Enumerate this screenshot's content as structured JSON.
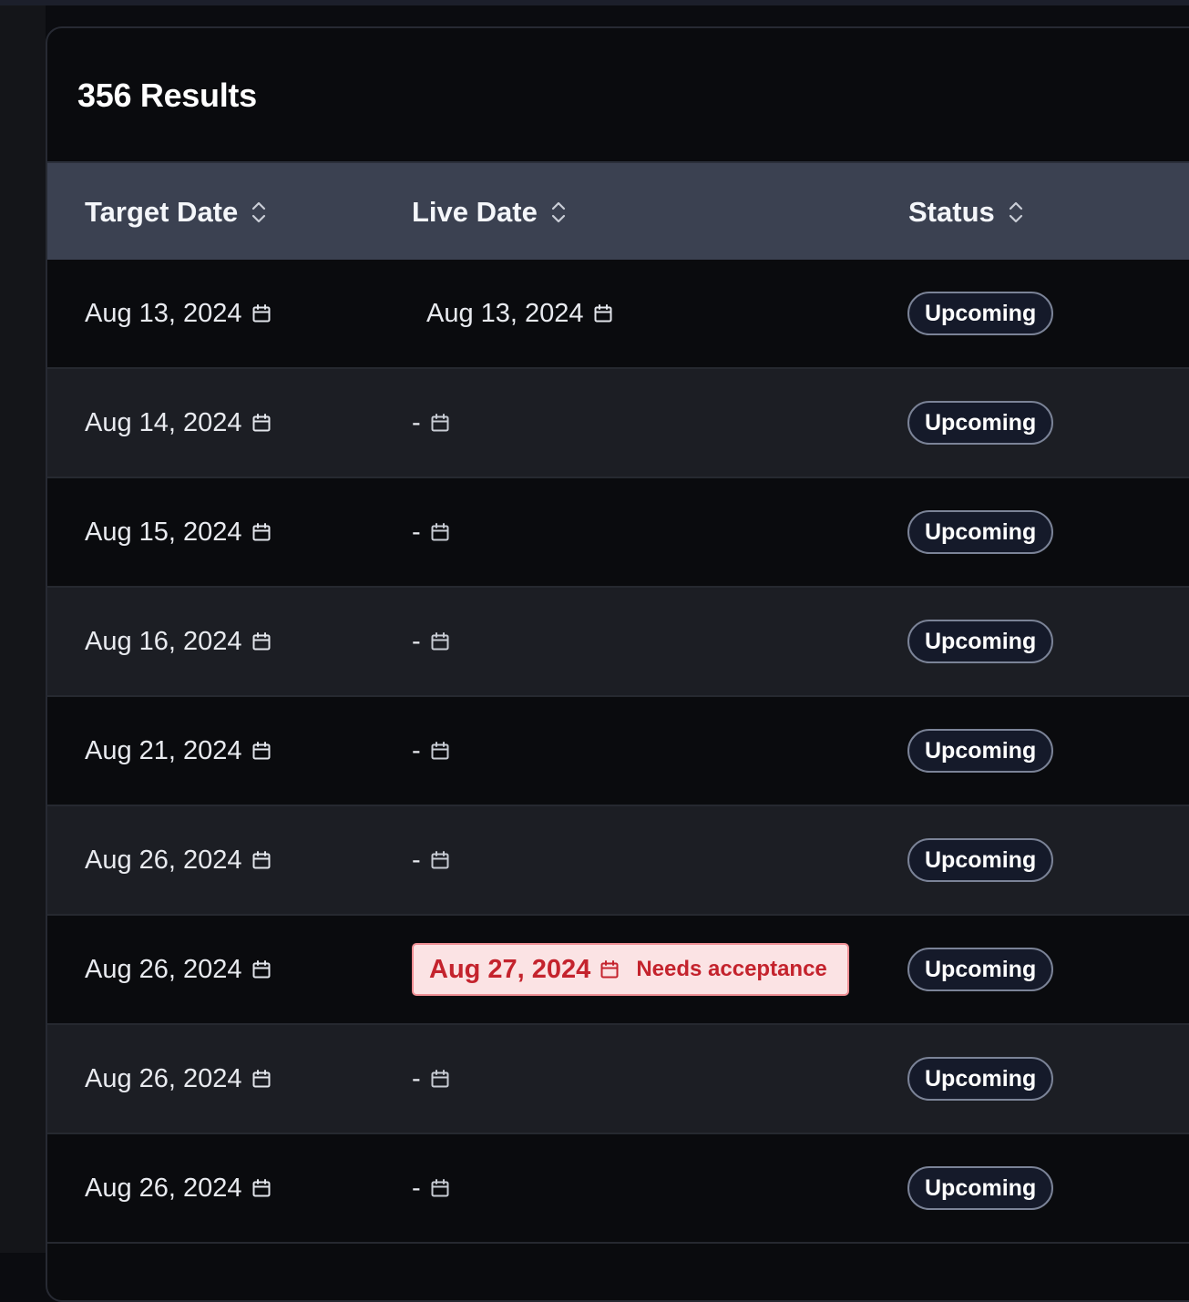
{
  "results": {
    "title": "356 Results"
  },
  "table": {
    "columns": [
      {
        "label": "Target Date"
      },
      {
        "label": "Live Date"
      },
      {
        "label": "Status"
      }
    ],
    "rows": [
      {
        "target_date": "Aug 13, 2024",
        "live_date": "Aug 13, 2024",
        "live_state": "date",
        "status": "Upcoming"
      },
      {
        "target_date": "Aug 14, 2024",
        "live_date": "-",
        "live_state": "empty",
        "status": "Upcoming"
      },
      {
        "target_date": "Aug 15, 2024",
        "live_date": "-",
        "live_state": "empty",
        "status": "Upcoming"
      },
      {
        "target_date": "Aug 16, 2024",
        "live_date": "-",
        "live_state": "empty",
        "status": "Upcoming"
      },
      {
        "target_date": "Aug 21, 2024",
        "live_date": "-",
        "live_state": "empty",
        "status": "Upcoming"
      },
      {
        "target_date": "Aug 26, 2024",
        "live_date": "-",
        "live_state": "empty",
        "status": "Upcoming"
      },
      {
        "target_date": "Aug 26, 2024",
        "live_date": "Aug 27, 2024",
        "live_state": "needs_acceptance",
        "live_note": "Needs acceptance",
        "status": "Upcoming"
      },
      {
        "target_date": "Aug 26, 2024",
        "live_date": "-",
        "live_state": "empty",
        "status": "Upcoming"
      },
      {
        "target_date": "Aug 26, 2024",
        "live_date": "-",
        "live_state": "empty",
        "status": "Upcoming"
      }
    ]
  },
  "icons": {
    "sort": "sort-chevrons-icon",
    "calendar": "calendar-icon"
  },
  "colors": {
    "header_bg": "#3b4151",
    "row_odd": "#0a0b0e",
    "row_even": "#1c1e24",
    "needs_bg": "#fbe3e4",
    "needs_text": "#c4232d",
    "badge_bg": "#151a2a"
  }
}
